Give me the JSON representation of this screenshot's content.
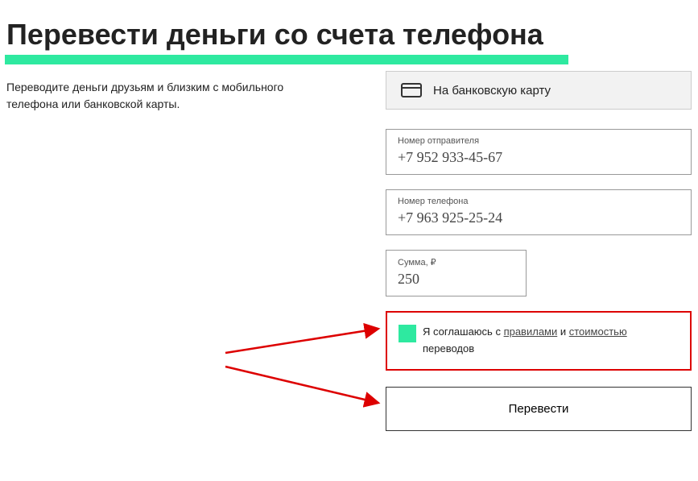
{
  "title": "Перевести деньги со счета телефона",
  "subtitle": "Переводите деньги друзьям и близким с мобильного телефона или банковской карты.",
  "tab": {
    "label": "На банковскую карту"
  },
  "fields": {
    "sender": {
      "label": "Номер отправителя",
      "value": "+7 952 933-45-67"
    },
    "phone": {
      "label": "Номер телефона",
      "value": "+7 963 925-25-24"
    },
    "amount": {
      "label": "Сумма, ₽",
      "value": "250"
    }
  },
  "agreement": {
    "prefix": "Я соглашаюсь с ",
    "link1": "правилами",
    "middle": " и ",
    "link2": "стоимостью",
    "suffix": " переводов"
  },
  "submit": "Перевести"
}
